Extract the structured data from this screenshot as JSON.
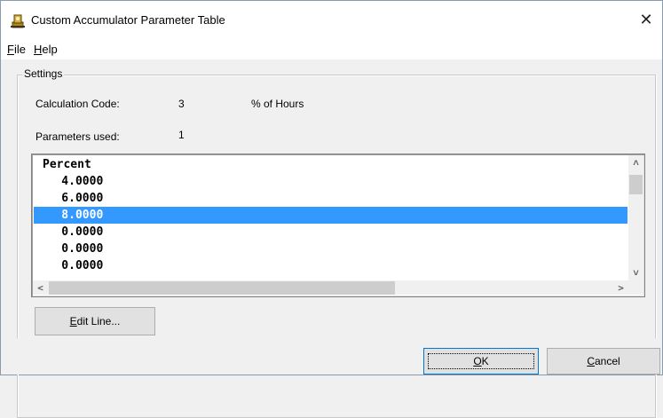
{
  "window": {
    "title": "Custom Accumulator Parameter Table",
    "close_glyph": "✕",
    "icon": "accumulator-app-icon"
  },
  "menu": {
    "file": {
      "accel": "F",
      "rest": "ile"
    },
    "help": {
      "accel": "H",
      "rest": "elp"
    }
  },
  "settings": {
    "group_label": "Settings",
    "calc_code_label": "Calculation Code:",
    "calc_code_value": "3",
    "calc_code_desc": "% of Hours",
    "params_used_label": "Parameters used:",
    "params_used_value": "1"
  },
  "list": {
    "header": "Percent",
    "rows": [
      "    4.0000",
      "    6.0000",
      "    8.0000",
      "    0.0000",
      "    0.0000",
      "    0.0000"
    ],
    "selected_index": 2,
    "scroll_up_glyph": "˄",
    "scroll_down_glyph": "˅",
    "scroll_left_glyph": "<",
    "scroll_right_glyph": ">"
  },
  "buttons": {
    "edit_line": {
      "accel": "E",
      "rest": "dit Line..."
    },
    "ok": {
      "accel": "O",
      "rest": "K"
    },
    "cancel": {
      "accel": "C",
      "rest": "ancel"
    }
  },
  "colors": {
    "selection": "#3399ff",
    "default_button_border": "#0078d7"
  }
}
